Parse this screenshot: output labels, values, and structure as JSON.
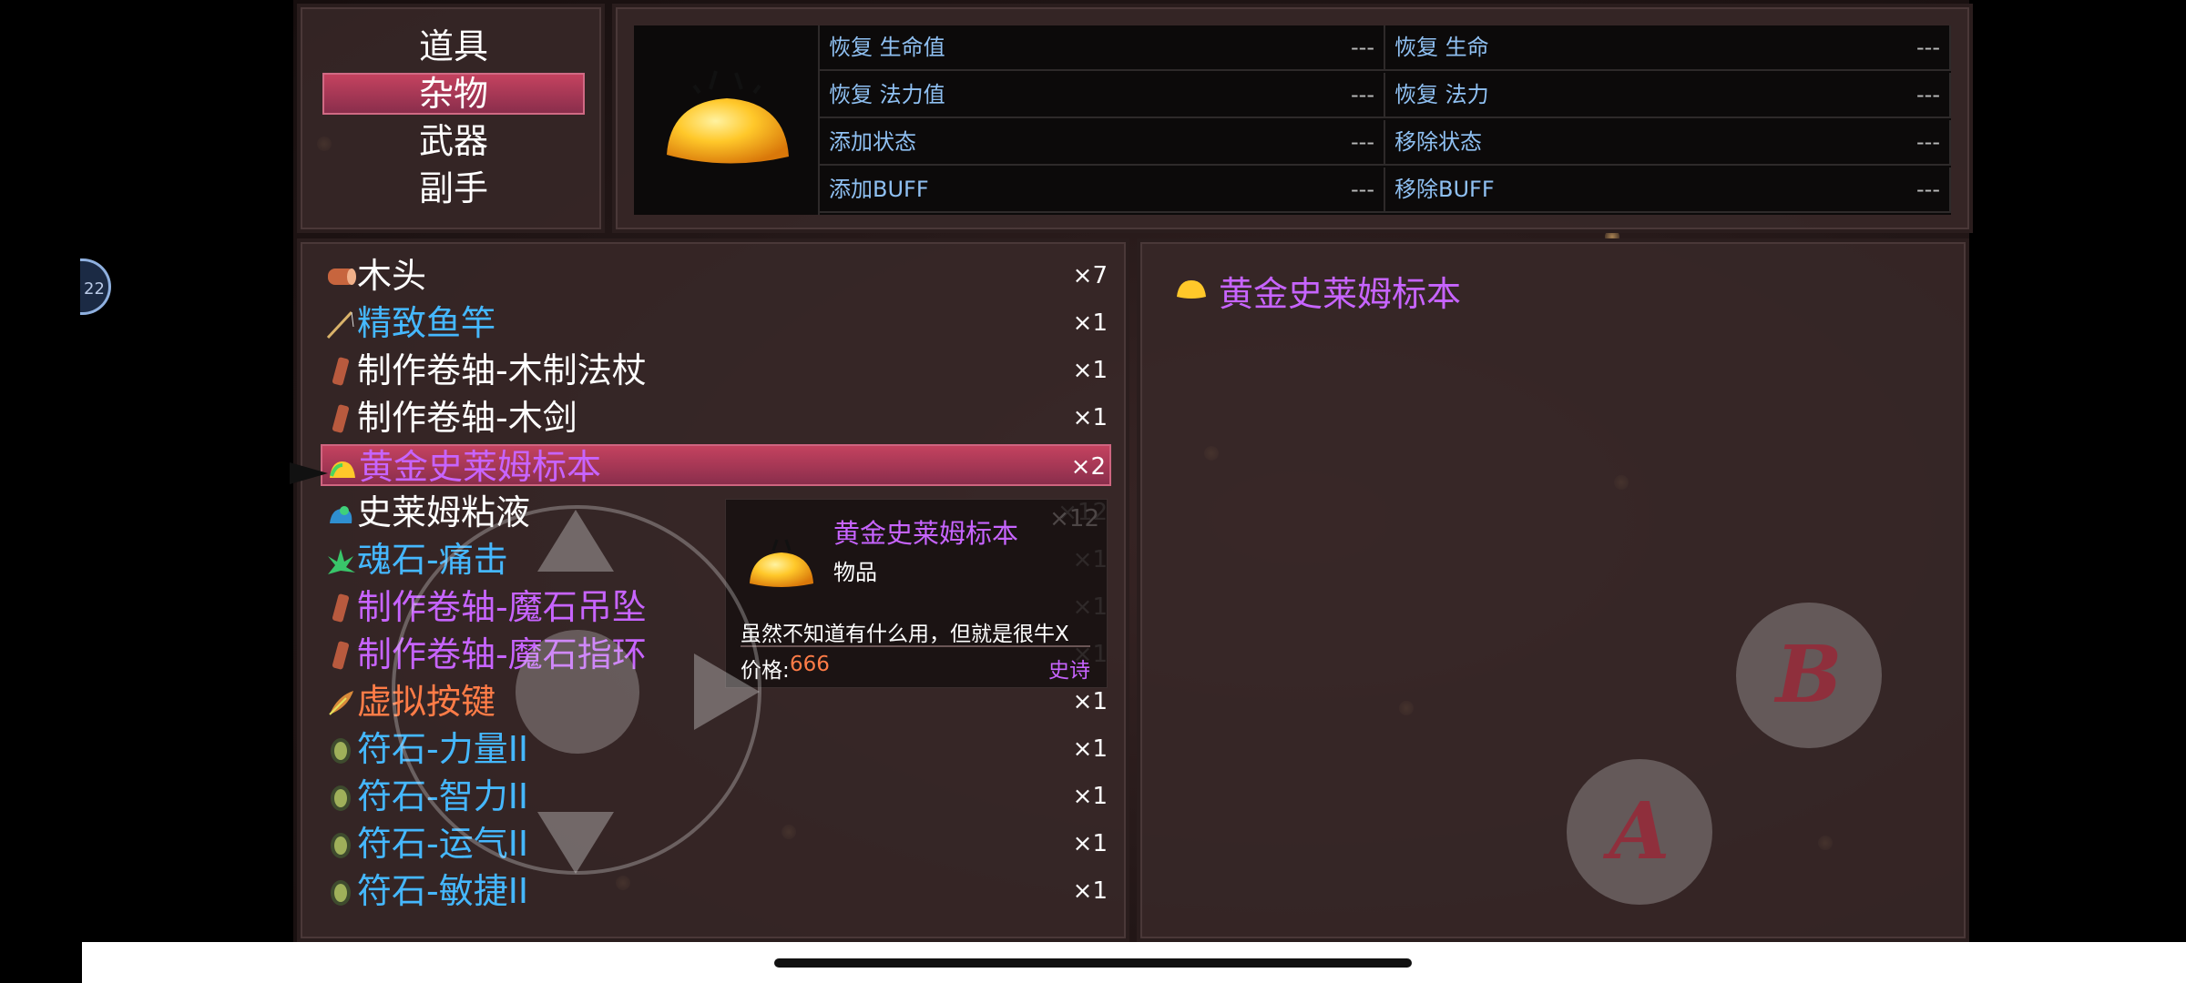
{
  "side_badge": "22",
  "categories": [
    {
      "label": "道具",
      "selected": false
    },
    {
      "label": "杂物",
      "selected": true
    },
    {
      "label": "武器",
      "selected": false
    },
    {
      "label": "副手",
      "selected": false
    }
  ],
  "stats": {
    "left": [
      {
        "label": "恢复 生命值",
        "value": "---"
      },
      {
        "label": "恢复 法力值",
        "value": "---"
      },
      {
        "label": "添加状态",
        "value": "---"
      },
      {
        "label": "添加BUFF",
        "value": "---"
      }
    ],
    "right": [
      {
        "label": "恢复 生命",
        "value": "---"
      },
      {
        "label": "恢复 法力",
        "value": "---"
      },
      {
        "label": "移除状态",
        "value": "---"
      },
      {
        "label": "移除BUFF",
        "value": "---"
      }
    ]
  },
  "items": [
    {
      "name": "木头",
      "count": "×7",
      "color": "#ffffff",
      "icon": "wood-log-icon"
    },
    {
      "name": "精致鱼竿",
      "count": "×1",
      "color": "#45b8ff",
      "icon": "fishing-rod-icon"
    },
    {
      "name": "制作卷轴-木制法杖",
      "count": "×1",
      "color": "#ffffff",
      "icon": "scroll-icon"
    },
    {
      "name": "制作卷轴-木剑",
      "count": "×1",
      "color": "#ffffff",
      "icon": "scroll-icon"
    },
    {
      "name": "黄金史莱姆标本",
      "count": "×2",
      "color": "#c764ff",
      "icon": "golden-slime-icon",
      "selected": true
    },
    {
      "name": "史莱姆粘液",
      "count": "×12",
      "color": "#ffffff",
      "icon": "slime-goo-icon"
    },
    {
      "name": "魂石-痛击",
      "count": "×1",
      "color": "#45b8ff",
      "icon": "soul-stone-icon"
    },
    {
      "name": "制作卷轴-魔石吊坠",
      "count": "×1",
      "color": "#c764ff",
      "icon": "scroll-icon"
    },
    {
      "name": "制作卷轴-魔石指环",
      "count": "×1",
      "color": "#c764ff",
      "icon": "scroll-icon"
    },
    {
      "name": "虚拟按键",
      "count": "×1",
      "color": "#ff7c47",
      "icon": "feather-icon"
    },
    {
      "name": "符石-力量II",
      "count": "×1",
      "color": "#45b8ff",
      "icon": "rune-stone-icon"
    },
    {
      "name": "符石-智力II",
      "count": "×1",
      "color": "#45b8ff",
      "icon": "rune-stone-icon"
    },
    {
      "name": "符石-运气II",
      "count": "×1",
      "color": "#45b8ff",
      "icon": "rune-stone-icon"
    },
    {
      "name": "符石-敏捷II",
      "count": "×1",
      "color": "#45b8ff",
      "icon": "rune-stone-icon"
    }
  ],
  "detail": {
    "title": "黄金史莱姆标本"
  },
  "tooltip": {
    "title": "黄金史莱姆标本",
    "type": "物品",
    "description": "虽然不知道有什么用，但就是很牛X",
    "price_label": "价格:",
    "price_value": "666",
    "rarity": "史诗"
  },
  "buttons": {
    "a_label": "A",
    "b_label": "B"
  },
  "colors": {
    "selected_bg": "#b23c58",
    "white": "#ffffff",
    "blue": "#45b8ff",
    "purple": "#c764ff",
    "orange": "#ff7c47"
  }
}
